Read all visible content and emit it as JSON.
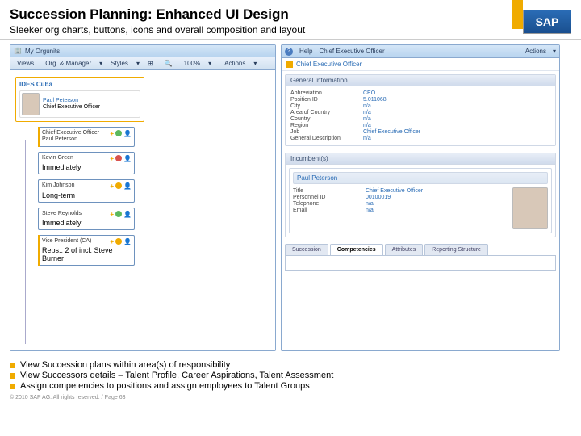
{
  "header": {
    "title": "Succession Planning: Enhanced UI Design",
    "subtitle": "Sleeker org charts, buttons, icons and overall composition and layout",
    "logo": "SAP"
  },
  "left_pane": {
    "titlebar": "My Orgunits",
    "toolbar": {
      "views": "Views",
      "manager": "Org. & Manager",
      "styles": "Styles",
      "zoom": "100%",
      "actions": "Actions"
    },
    "root": {
      "orgunit": "IDES Cuba",
      "person_name": "Paul Peterson",
      "person_title": "Chief Executive Officer"
    },
    "positions": [
      {
        "title": "Chief Executive Officer",
        "holder": "Paul Peterson",
        "accent": true,
        "status": "green"
      },
      {
        "title": "Kevin Green",
        "sub": "Immediately",
        "accent": false,
        "status": "red"
      },
      {
        "title": "Kim Johnson",
        "sub": "Long-term",
        "accent": false,
        "status": "yellow"
      },
      {
        "title": "Steve Reynolds",
        "sub": "Immediately",
        "accent": false,
        "status": "green"
      },
      {
        "title": "Vice President (CA)",
        "sub": "Reps.: 2 of incl. Steve Burner",
        "accent": true,
        "status": "yellow"
      }
    ]
  },
  "right_pane": {
    "titlebar": {
      "help": "Help",
      "crumb": "Chief Executive Officer",
      "actions": "Actions"
    },
    "header": "Chief Executive Officer",
    "gi_title": "General Information",
    "gi": [
      {
        "k": "Abbreviation",
        "v": "CEO"
      },
      {
        "k": "Position ID",
        "v": "5.011068"
      },
      {
        "k": "City",
        "v": "n/a"
      },
      {
        "k": "Area of Country",
        "v": "n/a"
      },
      {
        "k": "Country",
        "v": "n/a"
      },
      {
        "k": "Region",
        "v": "n/a"
      },
      {
        "k": "Job",
        "v": "Chief Executive Officer"
      },
      {
        "k": "General Description",
        "v": "n/a"
      }
    ],
    "incumbents_title": "Incumbent(s)",
    "incumbent": {
      "name": "Paul Peterson",
      "rows": [
        {
          "k": "Title",
          "v": "Chief Executive Officer"
        },
        {
          "k": "Personnel ID",
          "v": "00100019"
        },
        {
          "k": "Telephone",
          "v": "n/a"
        },
        {
          "k": "Email",
          "v": "n/a"
        }
      ]
    },
    "tabs": [
      "Succession",
      "Competencies",
      "Attributes",
      "Reporting Structure"
    ],
    "active_tab": 1
  },
  "bullets": [
    "View Succession plans within area(s) of responsibility",
    "View Successors details – Talent Profile, Career Aspirations, Talent Assessment",
    "Assign competencies to positions and assign employees to Talent Groups"
  ],
  "footer": "© 2010 SAP AG. All rights reserved. / Page 63"
}
